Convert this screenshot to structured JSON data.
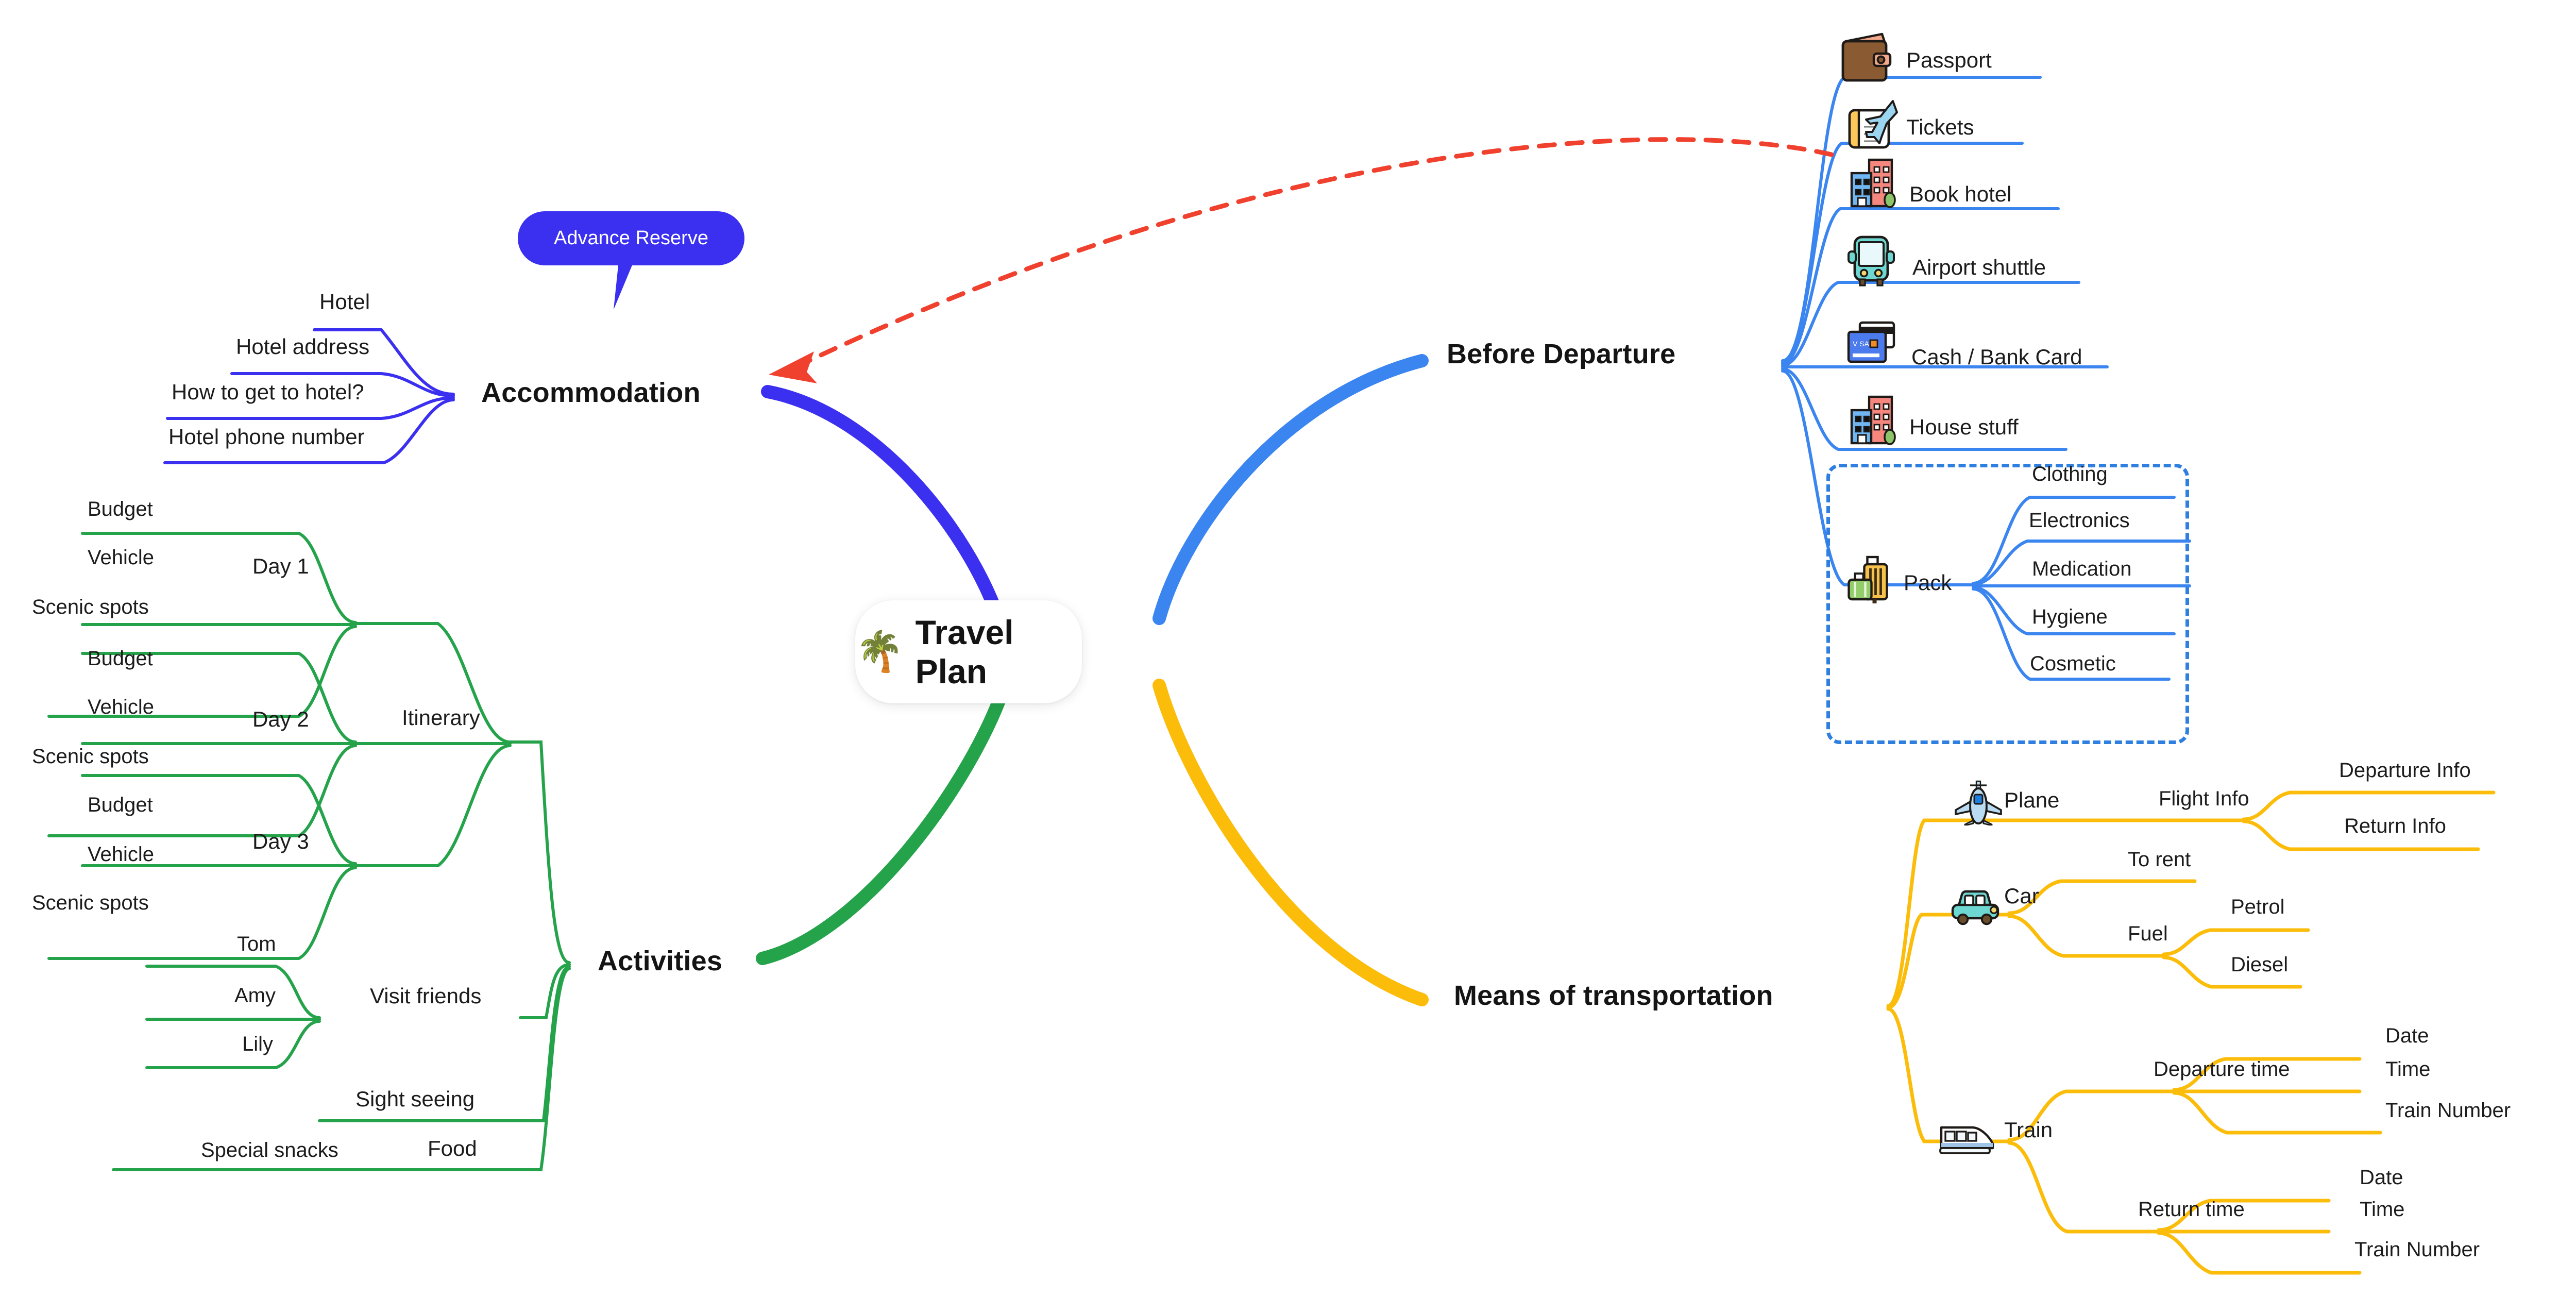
{
  "center": {
    "title": "Travel Plan",
    "icon": "palm-tree-icon",
    "emoji": "🌴"
  },
  "colors": {
    "accommodation": "#3b30f0",
    "before_departure": "#3b85f0",
    "activities": "#25a34b",
    "transportation": "#fbbc0a",
    "relation_arrow": "#f0402e",
    "group_box": "#2f7fe0"
  },
  "callout": {
    "label": "Advance Reserve"
  },
  "branches": [
    {
      "id": "accommodation",
      "label": "Accommodation",
      "color": "#3b30f0",
      "side": "left",
      "children": [
        {
          "label": "Hotel"
        },
        {
          "label": "Hotel address"
        },
        {
          "label": "How to get to hotel?"
        },
        {
          "label": "Hotel phone number"
        }
      ]
    },
    {
      "id": "activities",
      "label": "Activities",
      "color": "#25a34b",
      "side": "left",
      "children": [
        {
          "label": "Itinerary",
          "children": [
            {
              "label": "Day 1",
              "children": [
                {
                  "label": "Budget"
                },
                {
                  "label": "Vehicle"
                },
                {
                  "label": "Scenic spots"
                }
              ]
            },
            {
              "label": "Day 2",
              "children": [
                {
                  "label": "Budget"
                },
                {
                  "label": "Vehicle"
                },
                {
                  "label": "Scenic spots"
                }
              ]
            },
            {
              "label": "Day 3",
              "children": [
                {
                  "label": "Budget"
                },
                {
                  "label": "Vehicle"
                },
                {
                  "label": "Scenic spots"
                }
              ]
            }
          ]
        },
        {
          "label": "Visit friends",
          "children": [
            {
              "label": "Tom"
            },
            {
              "label": "Amy"
            },
            {
              "label": "Lily"
            }
          ]
        },
        {
          "label": "Sight seeing"
        },
        {
          "label": "Food",
          "children": [
            {
              "label": "Special snacks"
            }
          ]
        }
      ]
    },
    {
      "id": "before-departure",
      "label": "Before Departure",
      "color": "#3b85f0",
      "side": "right",
      "children": [
        {
          "label": "Passport",
          "icon": "passport-wallet-icon"
        },
        {
          "label": "Tickets",
          "icon": "airline-ticket-icon"
        },
        {
          "label": "Book hotel",
          "icon": "buildings-icon"
        },
        {
          "label": "Airport shuttle",
          "icon": "bus-icon"
        },
        {
          "label": "Cash / Bank Card",
          "icon": "credit-card-icon"
        },
        {
          "label": "House stuff",
          "icon": "buildings-icon"
        },
        {
          "label": "Pack",
          "icon": "luggage-icon",
          "grouped": true,
          "children": [
            {
              "label": "Clothing"
            },
            {
              "label": "Electronics"
            },
            {
              "label": "Medication"
            },
            {
              "label": "Hygiene"
            },
            {
              "label": "Cosmetic"
            }
          ]
        }
      ]
    },
    {
      "id": "transportation",
      "label": "Means of transportation",
      "color": "#fbbc0a",
      "side": "right",
      "children": [
        {
          "label": "Plane",
          "icon": "airplane-icon",
          "children": [
            {
              "label": "Flight Info",
              "children": [
                {
                  "label": "Departure Info"
                },
                {
                  "label": "Return Info"
                }
              ]
            }
          ]
        },
        {
          "label": "Car",
          "icon": "car-icon",
          "children": [
            {
              "label": "To rent"
            },
            {
              "label": "Fuel",
              "children": [
                {
                  "label": "Petrol"
                },
                {
                  "label": "Diesel"
                }
              ]
            }
          ]
        },
        {
          "label": "Train",
          "icon": "train-icon",
          "children": [
            {
              "label": "Departure time",
              "children": [
                {
                  "label": "Date"
                },
                {
                  "label": "Time"
                },
                {
                  "label": "Train Number"
                }
              ]
            },
            {
              "label": "Return time",
              "children": [
                {
                  "label": "Date"
                },
                {
                  "label": "Time"
                },
                {
                  "label": "Train Number"
                }
              ]
            }
          ]
        }
      ]
    }
  ],
  "relation": {
    "from": "Book hotel",
    "to": "Accommodation",
    "style": "dashed-arrow"
  },
  "labels": {
    "accommodation": "Accommodation",
    "activities": "Activities",
    "before_departure": "Before Departure",
    "transportation": "Means of transportation",
    "hotel": "Hotel",
    "hotel_address": "Hotel address",
    "how_to_get": "How to get to hotel?",
    "hotel_phone": "Hotel phone number",
    "itinerary": "Itinerary",
    "day1": "Day 1",
    "day2": "Day 2",
    "day3": "Day 3",
    "budget1": "Budget",
    "vehicle1": "Vehicle",
    "scenic1": "Scenic spots",
    "budget2": "Budget",
    "vehicle2": "Vehicle",
    "scenic2": "Scenic spots",
    "budget3": "Budget",
    "vehicle3": "Vehicle",
    "scenic3": "Scenic spots",
    "visit_friends": "Visit friends",
    "tom": "Tom",
    "amy": "Amy",
    "lily": "Lily",
    "sight_seeing": "Sight seeing",
    "food": "Food",
    "special_snacks": "Special snacks",
    "passport": "Passport",
    "tickets": "Tickets",
    "book_hotel": "Book hotel",
    "airport_shuttle": "Airport shuttle",
    "cash_bank_card": "Cash / Bank Card",
    "house_stuff": "House stuff",
    "pack": "Pack",
    "clothing": "Clothing",
    "electronics": "Electronics",
    "medication": "Medication",
    "hygiene": "Hygiene",
    "cosmetic": "Cosmetic",
    "plane": "Plane",
    "flight_info": "Flight Info",
    "departure_info": "Departure Info",
    "return_info": "Return Info",
    "car": "Car",
    "to_rent": "To rent",
    "fuel": "Fuel",
    "petrol": "Petrol",
    "diesel": "Diesel",
    "train": "Train",
    "departure_time": "Departure time",
    "dep_date": "Date",
    "dep_time": "Time",
    "dep_number": "Train Number",
    "return_time": "Return time",
    "ret_date": "Date",
    "ret_time": "Time",
    "ret_number": "Train Number"
  }
}
